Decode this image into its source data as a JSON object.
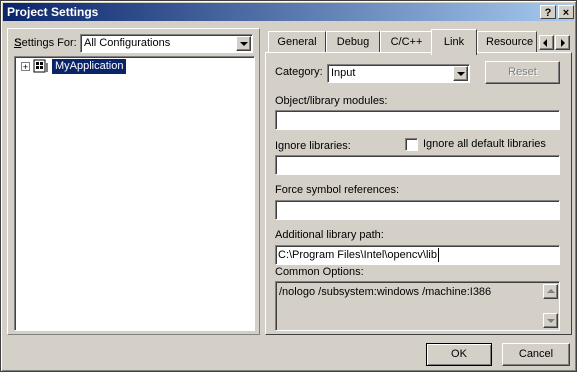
{
  "window": {
    "title": "Project Settings",
    "help_btn": "?",
    "close_btn": "×"
  },
  "left": {
    "settings_for_label": "Settings For:",
    "configuration": "All Configurations",
    "tree_expander": "+",
    "tree_item": "MyApplication"
  },
  "tabs": [
    {
      "label": "General"
    },
    {
      "label": "Debug"
    },
    {
      "label": "C/C++"
    },
    {
      "label": "Link"
    },
    {
      "label": "Resource"
    }
  ],
  "link": {
    "category_label": "Category:",
    "category_value": "Input",
    "reset_label": "Reset",
    "obj_modules_label": "Object/library modules:",
    "obj_modules_value": "",
    "ignore_libs_label": "Ignore libraries:",
    "ignore_all_label": "Ignore all default libraries",
    "ignore_libs_value": "",
    "force_symbol_label": "Force symbol references:",
    "force_symbol_value": "",
    "additional_path_label": "Additional library path:",
    "additional_path_value": "C:\\Program Files\\Intel\\opencv\\lib",
    "common_options_label": "Common Options:",
    "common_options_value": "/nologo /subsystem:windows /machine:I386"
  },
  "footer": {
    "ok_label": "OK",
    "cancel_label": "Cancel"
  }
}
